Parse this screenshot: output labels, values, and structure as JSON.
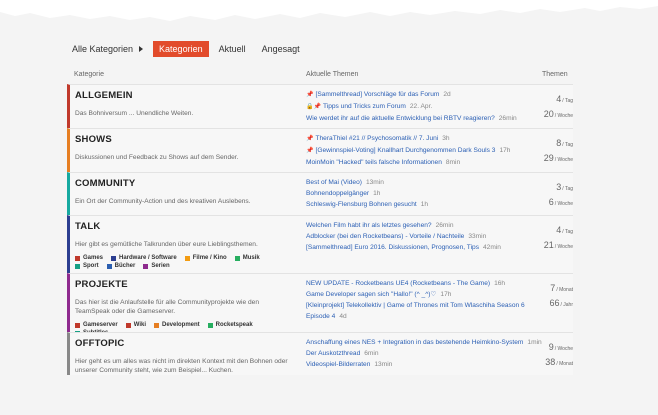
{
  "nav": {
    "all_categories": "Alle Kategorien",
    "tabs": [
      {
        "label": "Kategorien",
        "active": true
      },
      {
        "label": "Aktuell",
        "active": false
      },
      {
        "label": "Angesagt",
        "active": false
      }
    ]
  },
  "headers": {
    "category": "Kategorie",
    "topics": "Aktuelle Themen",
    "themes": "Themen"
  },
  "categories": [
    {
      "title": "ALLGEMEIN",
      "description": "Das Bohniversum ... Unendliche Weiten.",
      "color": "#c0392b",
      "topics": [
        {
          "icon": "pin-icon",
          "title": "[Sammelthread] Vorschläge für das Forum",
          "time": "2d"
        },
        {
          "icon": "lock-pin-icon",
          "title": "Tipps und Tricks zum Forum",
          "time": "22. Apr."
        },
        {
          "icon": "",
          "title": "Wie werdet ihr auf die aktuelle Entwicklung bei RBTV reagieren?",
          "time": "26min"
        }
      ],
      "stats": [
        {
          "num": "4",
          "unit": "/ Tag"
        },
        {
          "num": "20",
          "unit": "/ Woche"
        }
      ]
    },
    {
      "title": "SHOWS",
      "description": "Diskussionen und Feedback zu Shows auf dem Sender.",
      "color": "#e67e22",
      "topics": [
        {
          "icon": "pin-icon",
          "title": "TheraThiel #21 // Psychosomatik // 7. Juni",
          "time": "3h"
        },
        {
          "icon": "pin-icon",
          "title": "[Gewinnspiel-Voting] Knallhart Durchgenommen Dark Souls 3",
          "time": "17h"
        },
        {
          "icon": "",
          "title": "MoinMoin \"Hacked\" teils falsche Informationen",
          "time": "8min"
        }
      ],
      "stats": [
        {
          "num": "8",
          "unit": "/ Tag"
        },
        {
          "num": "29",
          "unit": "/ Woche"
        }
      ]
    },
    {
      "title": "COMMUNITY",
      "description": "Ein Ort der Community-Action und des kreativen Auslebens.",
      "color": "#16a9a0",
      "topics": [
        {
          "icon": "",
          "title": "Best of Mai (Video)",
          "time": "13min"
        },
        {
          "icon": "",
          "title": "Bohnendoppelgänger",
          "time": "1h"
        },
        {
          "icon": "",
          "title": "Schleswig-Flensburg Bohnen gesucht",
          "time": "1h"
        }
      ],
      "stats": [
        {
          "num": "3",
          "unit": "/ Tag"
        },
        {
          "num": "6",
          "unit": "/ Woche"
        }
      ]
    },
    {
      "title": "TALK",
      "description": "Hier gibt es gemütliche Talkrunden über eure Lieblingsthemen.",
      "color": "#2c3e90",
      "subcategories": [
        {
          "label": "Games",
          "color": "#c0392b"
        },
        {
          "label": "Hardware / Software",
          "color": "#2c3e90"
        },
        {
          "label": "Filme / Kino",
          "color": "#f39c12"
        },
        {
          "label": "Musik",
          "color": "#27ae60"
        },
        {
          "label": "Sport",
          "color": "#16a085"
        },
        {
          "label": "Bücher",
          "color": "#2c5fb0"
        },
        {
          "label": "Serien",
          "color": "#8e2a8e"
        }
      ],
      "topics": [
        {
          "icon": "",
          "title": "Welchen Film habt ihr als letztes gesehen?",
          "time": "26min"
        },
        {
          "icon": "",
          "title": "Adblocker (bei den Rocketbeans) - Vorteile / Nachteile",
          "time": "33min"
        },
        {
          "icon": "",
          "title": "[Sammelthread] Euro 2016. Diskussionen, Prognosen, Tips",
          "time": "42min"
        }
      ],
      "stats": [
        {
          "num": "4",
          "unit": "/ Tag"
        },
        {
          "num": "21",
          "unit": "/ Woche"
        }
      ]
    },
    {
      "title": "PROJEKTE",
      "description": "Das hier ist die Anlaufstelle für alle Communityprojekte wie den TeamSpeak oder die Gameserver.",
      "color": "#8e2a8e",
      "subcategories": [
        {
          "label": "Gameserver",
          "color": "#c0392b"
        },
        {
          "label": "Wiki",
          "color": "#c0392b"
        },
        {
          "label": "Development",
          "color": "#e67e22"
        },
        {
          "label": "Rocketspeak",
          "color": "#27ae60"
        },
        {
          "label": "Subtitles",
          "color": "#16a085"
        }
      ],
      "topics": [
        {
          "icon": "",
          "title": "NEW UPDATE - Rocketbeans UE4 (Rocketbeans - The Game)",
          "time": "16h"
        },
        {
          "icon": "",
          "title": "Game Developer sagen sich \"Hallo!\" (^ _^)♡",
          "time": "17h"
        },
        {
          "icon": "",
          "title": "[Kleinprojekt] Telekollektiv | Game of Thrones mit Tom Wlaschiha Season 6",
          "time": ""
        },
        {
          "icon": "",
          "title": "Episode 4",
          "time": "4d"
        }
      ],
      "stats": [
        {
          "num": "7",
          "unit": "/ Monat"
        },
        {
          "num": "66",
          "unit": "/ Jahr"
        }
      ]
    },
    {
      "title": "OFFTOPIC",
      "description": "Hier geht es um alles was nicht im direkten Kontext mit den Bohnen oder unserer Community steht, wie zum Beispiel... Kuchen.",
      "color": "#888888",
      "topics": [
        {
          "icon": "",
          "title": "Anschaffung eines NES + Integration in das bestehende Heimkino-System",
          "time": "1min"
        },
        {
          "icon": "",
          "title": "Der Auskotzthread",
          "time": "6min"
        },
        {
          "icon": "",
          "title": "Videospiel-Bilderraten",
          "time": "13min"
        }
      ],
      "stats": [
        {
          "num": "9",
          "unit": "/ Woche"
        },
        {
          "num": "38",
          "unit": "/ Monat"
        }
      ]
    }
  ]
}
